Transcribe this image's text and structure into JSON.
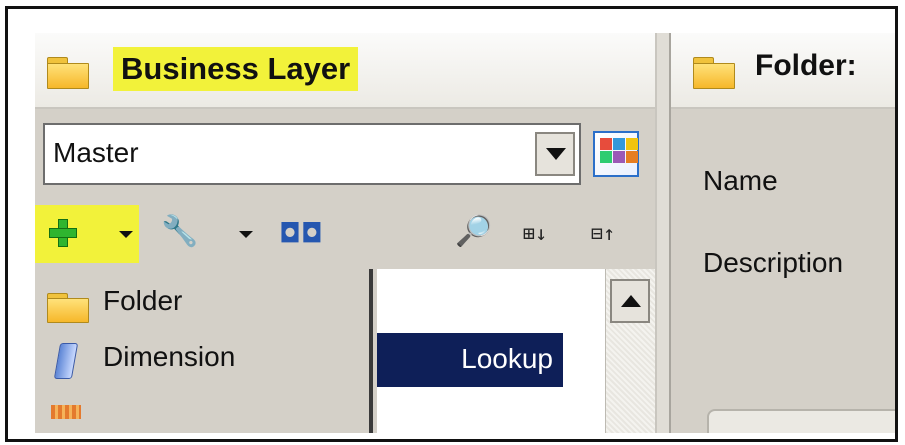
{
  "left_panel": {
    "title": "Business Layer",
    "view_selector": {
      "value": "Master"
    },
    "toolbar": {
      "icons": [
        "add-icon",
        "chevron-down-icon",
        "wrench-properties-icon",
        "chevron-down-icon",
        "binoculars-icon",
        "magnifier-icon",
        "expand-all-icon",
        "collapse-all-icon"
      ]
    },
    "insert_menu": {
      "items": [
        {
          "label": "Folder",
          "icon": "folder-icon"
        },
        {
          "label": "Dimension",
          "icon": "dimension-icon"
        }
      ]
    },
    "tree_list": {
      "selected_item": "Lookup"
    }
  },
  "right_panel": {
    "title": "Folder:",
    "fields": {
      "name_label": "Name",
      "description_label": "Description"
    }
  },
  "colors": {
    "highlight": "#f2f23a",
    "selection": "#0e1f58",
    "panel_bg": "#d4d0c8"
  }
}
